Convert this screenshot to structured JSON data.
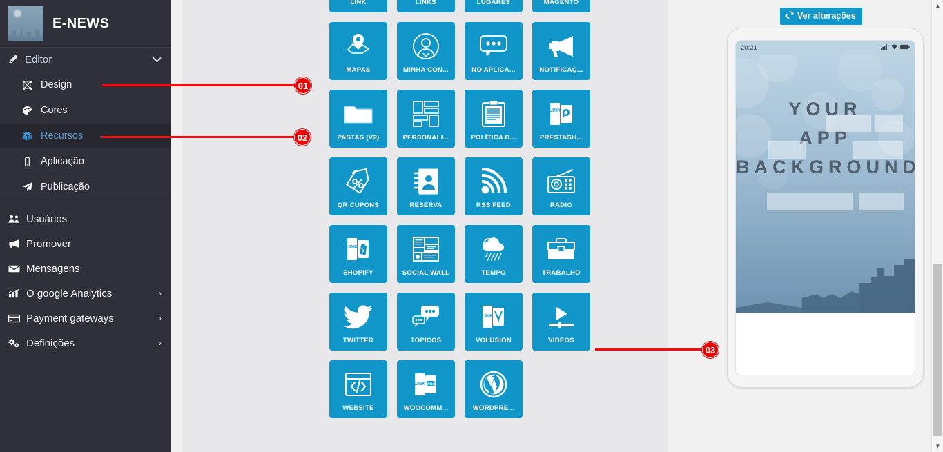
{
  "app": {
    "brand_title": "E-NEWS",
    "accent_blue": "#1196c9",
    "sidebar_bg": "#2f3039",
    "annotation_red": "#ee0000"
  },
  "sidebar": {
    "group": {
      "label": "Editor",
      "icon": "pencil-icon",
      "chevron": "chevron-down-icon"
    },
    "sub_items": [
      {
        "label": "Design",
        "icon": "design-icon",
        "active": false
      },
      {
        "label": "Cores",
        "icon": "palette-icon",
        "active": false
      },
      {
        "label": "Recursos",
        "icon": "cube-icon",
        "active": true
      },
      {
        "label": "Aplicação",
        "icon": "mobile-icon",
        "active": false
      },
      {
        "label": "Publicação",
        "icon": "paper-plane-icon",
        "active": false
      }
    ],
    "main_items": [
      {
        "label": "Usuários",
        "icon": "users-icon",
        "chevron": false
      },
      {
        "label": "Promover",
        "icon": "bullhorn-icon",
        "chevron": false
      },
      {
        "label": "Mensagens",
        "icon": "envelope-icon",
        "chevron": false
      },
      {
        "label": "O google Analytics",
        "icon": "bar-chart-icon",
        "chevron": true
      },
      {
        "label": "Payment gateways",
        "icon": "credit-card-icon",
        "chevron": true
      },
      {
        "label": "Definições",
        "icon": "gears-icon",
        "chevron": true
      }
    ],
    "chevron_right": "›"
  },
  "features": {
    "tiles": [
      {
        "label": "LINK",
        "icon": "chain-link-icon"
      },
      {
        "label": "LINKS",
        "icon": "chain-links-icon"
      },
      {
        "label": "LUGARES",
        "icon": "map-pins-icon"
      },
      {
        "label": "MAGENTO",
        "icon": "magento-door-icon"
      },
      {
        "label": "MAPAS",
        "icon": "map-pin-icon"
      },
      {
        "label": "MINHA CON...",
        "icon": "my-account-icon"
      },
      {
        "label": "NO APLICA...",
        "icon": "chat-bubble-icon"
      },
      {
        "label": "NOTIFICAÇ...",
        "icon": "megaphone-icon"
      },
      {
        "label": "PASTAS (V2)",
        "icon": "folder-icon"
      },
      {
        "label": "PERSONALI...",
        "icon": "layout-blocks-icon"
      },
      {
        "label": "POLÍTICA D...",
        "icon": "clipboard-icon"
      },
      {
        "label": "PRESTASH...",
        "icon": "prestashop-door-icon"
      },
      {
        "label": "QR CUPONS",
        "icon": "coupon-tag-icon"
      },
      {
        "label": "RESERVA",
        "icon": "contact-book-icon"
      },
      {
        "label": "RSS FEED",
        "icon": "rss-icon"
      },
      {
        "label": "RÁDIO",
        "icon": "radio-icon"
      },
      {
        "label": "SHOPIFY",
        "icon": "shopify-door-icon"
      },
      {
        "label": "SOCIAL WALL",
        "icon": "social-wall-icon"
      },
      {
        "label": "TEMPO",
        "icon": "weather-cloud-rain-icon"
      },
      {
        "label": "TRABALHO",
        "icon": "briefcase-icon"
      },
      {
        "label": "TWITTER",
        "icon": "twitter-bird-icon"
      },
      {
        "label": "TÓPICOS",
        "icon": "topics-bubbles-icon"
      },
      {
        "label": "VOLUSION",
        "icon": "volusion-door-icon"
      },
      {
        "label": "VÍDEOS",
        "icon": "video-play-icon"
      },
      {
        "label": "WEBSITE",
        "icon": "code-window-icon"
      },
      {
        "label": "WOOCOMM...",
        "icon": "woocommerce-door-icon"
      },
      {
        "label": "WORDPRE...",
        "icon": "wordpress-icon"
      }
    ]
  },
  "preview": {
    "view_changes_label": "Ver alterações",
    "view_changes_icon": "refresh-icon",
    "status_time": "20:21",
    "status_icons": [
      "signal-icon",
      "wifi-icon",
      "battery-icon"
    ],
    "background_text_lines": [
      "YOUR",
      "APP",
      "BACKGROUND"
    ]
  },
  "annotations": [
    {
      "id": "01",
      "target": "Design"
    },
    {
      "id": "02",
      "target": "Recursos"
    },
    {
      "id": "03",
      "target": "VÍDEOS"
    }
  ],
  "scrollbar": {
    "up_arrow": "▲",
    "down_arrow": "▼"
  }
}
